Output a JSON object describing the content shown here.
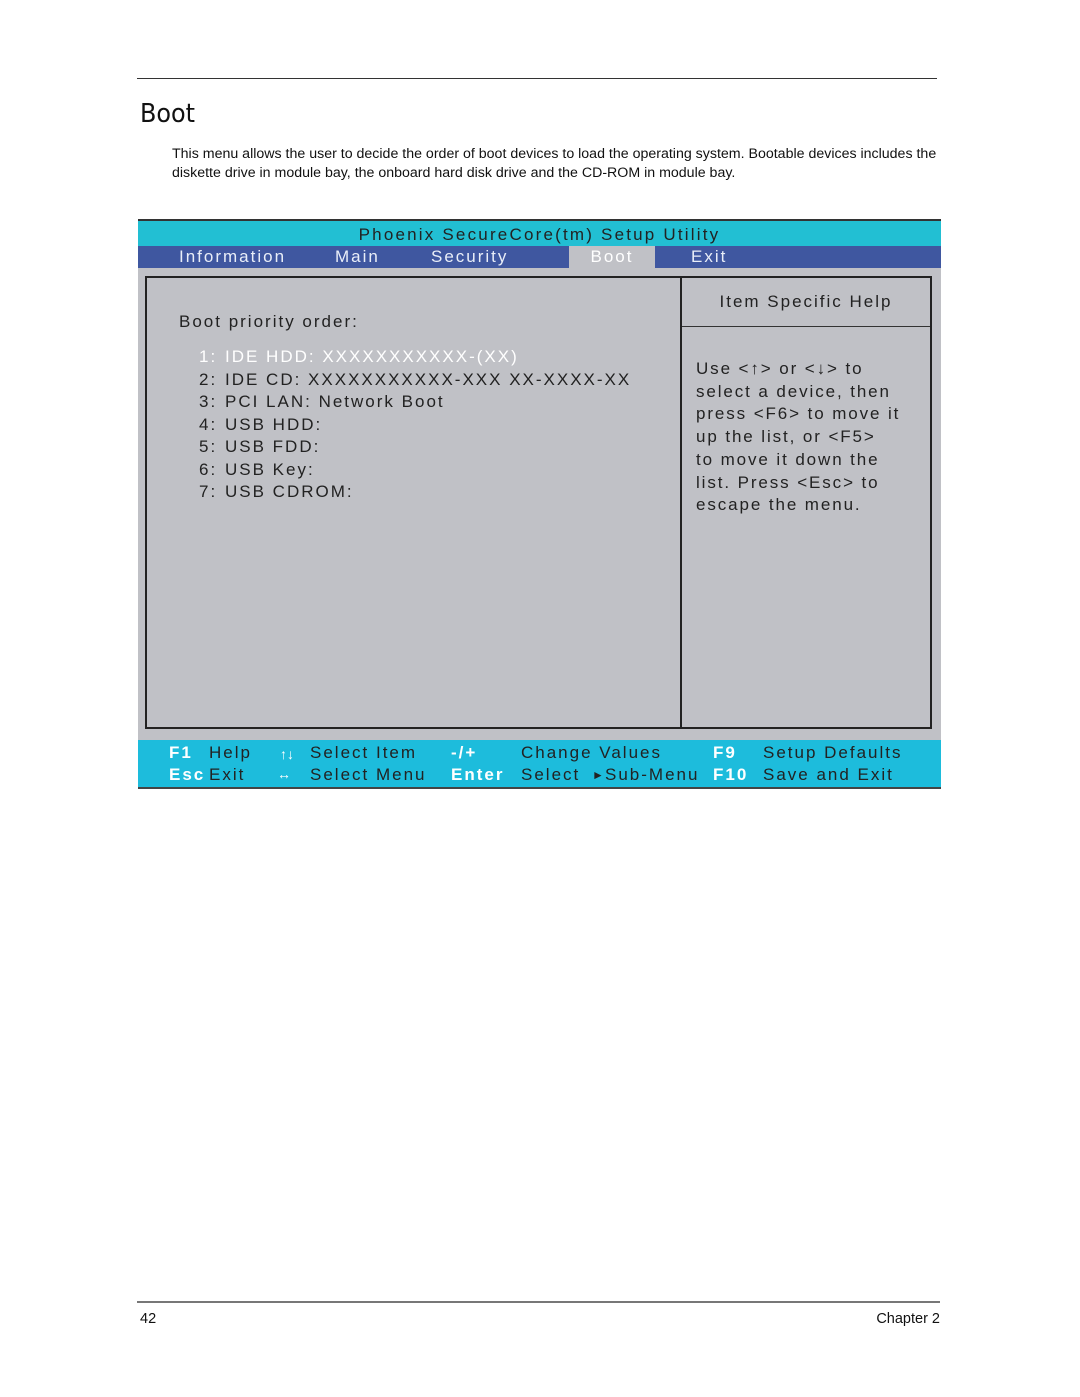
{
  "page": {
    "section_title": "Boot",
    "intro": "This menu allows the user to decide the order of boot devices to load the operating system. Bootable devices includes the diskette drive in module bay, the onboard hard disk drive and the CD-ROM in module bay.",
    "page_number": "42",
    "chapter": "Chapter 2"
  },
  "bios": {
    "title": "Phoenix SecureCore(tm) Setup Utility",
    "menu": [
      {
        "label": "Information",
        "active": false
      },
      {
        "label": "Main",
        "active": false
      },
      {
        "label": "Security",
        "active": false
      },
      {
        "label": "Boot",
        "active": true
      },
      {
        "label": "Exit",
        "active": false
      }
    ],
    "boot_priority_label": "Boot priority order:",
    "boot_items": [
      {
        "num": "1:",
        "label": "IDE HDD: XXXXXXXXXXX-(XX)",
        "selected": true
      },
      {
        "num": "2:",
        "label": "IDE CD: XXXXXXXXXXX-XXX XX-XXXX-XX",
        "selected": false
      },
      {
        "num": "3:",
        "label": "PCI LAN: Network Boot",
        "selected": false
      },
      {
        "num": "4:",
        "label": "USB HDD:",
        "selected": false
      },
      {
        "num": "5:",
        "label": "USB FDD:",
        "selected": false
      },
      {
        "num": "6:",
        "label": "USB Key:",
        "selected": false
      },
      {
        "num": "7:",
        "label": "USB CDROM:",
        "selected": false
      }
    ],
    "help_title": "Item Specific Help",
    "help_text": "Use <↑> or <↓> to\nselect a device, then\npress <F6> to move it\nup the list, or <F5>\nto move it down the\nlist. Press <Esc> to\nescape the menu.",
    "footer": {
      "f1_key": "F1",
      "f1_label": "Help",
      "updown_icon": "↑↓",
      "select_item": "Select Item",
      "minus_plus_key": "-/+",
      "change_values": "Change Values",
      "f9_key": "F9",
      "setup_defaults": "Setup Defaults",
      "esc_key": "Esc",
      "esc_label": "Exit",
      "leftright_icon": "↔",
      "select_menu": "Select Menu",
      "enter_key": "Enter",
      "select_label": "Select",
      "submenu_icon": "►",
      "submenu_label": "Sub-Menu",
      "f10_key": "F10",
      "save_exit": "Save and Exit"
    },
    "colors": {
      "title_bar": "#22bfd3",
      "menu_bar": "#3f57a0",
      "body": "#c0c1c6",
      "footer_bar": "#1dbcdc"
    }
  }
}
